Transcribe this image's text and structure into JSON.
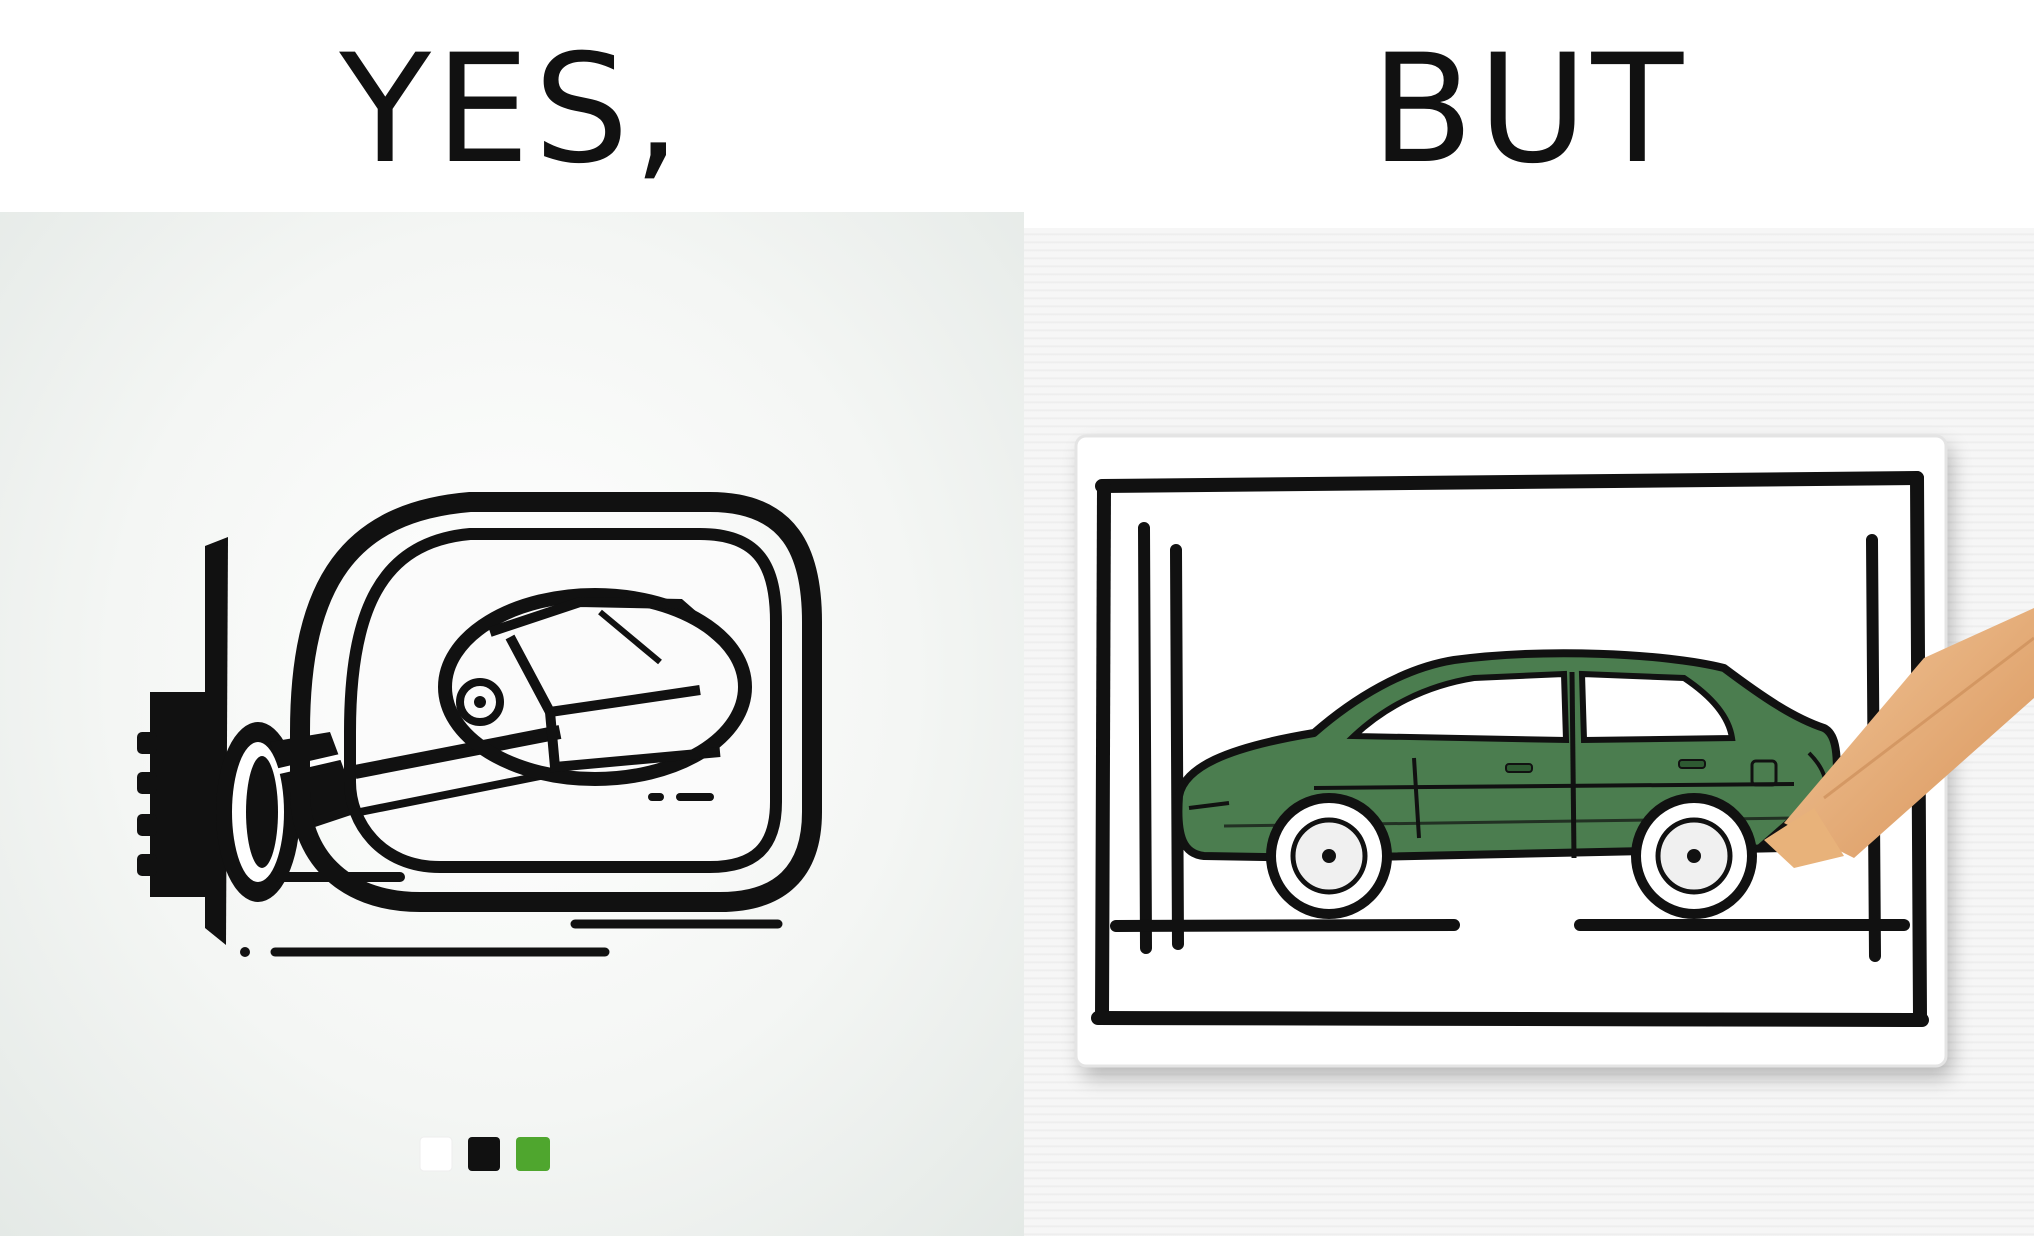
{
  "captions": {
    "left": "YES,",
    "right": "BUT"
  },
  "palette": {
    "swatches": [
      "#ffffff",
      "#111111",
      "#4fa62e"
    ],
    "car_body": "#4b7d4f",
    "ink": "#111111"
  },
  "icons": {
    "left_panel": "side-mirror-icon",
    "right_panel": "car-drawing-on-card",
    "tool": "pencil-icon"
  }
}
